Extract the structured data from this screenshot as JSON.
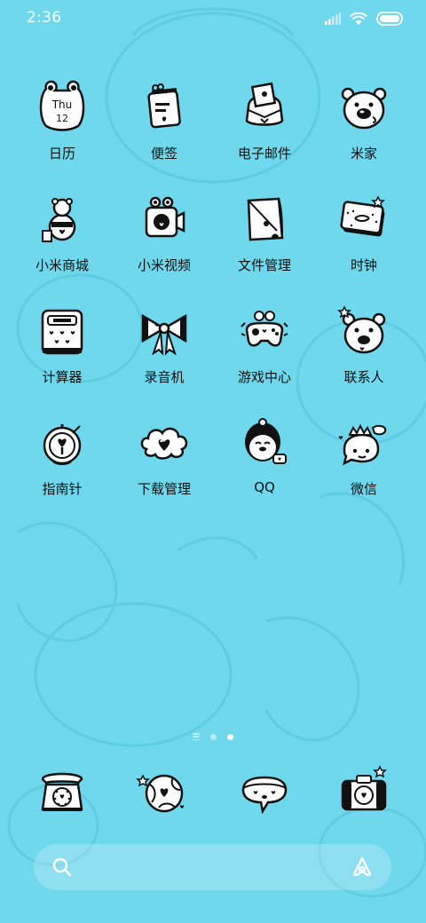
{
  "status_bar": {
    "time": "2:36"
  },
  "apps": [
    {
      "label": "日历",
      "icon": "calendar-icon",
      "date_weekday": "Thu",
      "date_day": "12"
    },
    {
      "label": "便签",
      "icon": "notes-icon"
    },
    {
      "label": "电子邮件",
      "icon": "email-icon"
    },
    {
      "label": "米家",
      "icon": "mijia-bear-icon"
    },
    {
      "label": "小米商城",
      "icon": "mi-store-icon"
    },
    {
      "label": "小米视频",
      "icon": "mi-video-icon"
    },
    {
      "label": "文件管理",
      "icon": "file-manager-icon"
    },
    {
      "label": "时钟",
      "icon": "clock-icon"
    },
    {
      "label": "计算器",
      "icon": "calculator-icon"
    },
    {
      "label": "录音机",
      "icon": "recorder-bow-icon"
    },
    {
      "label": "游戏中心",
      "icon": "game-center-icon"
    },
    {
      "label": "联系人",
      "icon": "contacts-bear-icon"
    },
    {
      "label": "指南针",
      "icon": "compass-icon"
    },
    {
      "label": "下载管理",
      "icon": "downloads-cloud-icon"
    },
    {
      "label": "QQ",
      "icon": "qq-penguin-icon"
    },
    {
      "label": "微信",
      "icon": "wechat-icon"
    }
  ],
  "page_indicator": {
    "pages": 2,
    "active_page": 2
  },
  "dock": [
    {
      "icon": "phone-icon"
    },
    {
      "icon": "browser-globe-icon"
    },
    {
      "icon": "messages-bubble-icon"
    },
    {
      "icon": "camera-icon"
    }
  ],
  "search_bar": {
    "icons": [
      "search-icon",
      "assistant-icon"
    ]
  },
  "colors": {
    "wallpaper": "#6fd8ec",
    "wallpaper_pattern": "#5fcde2",
    "icon_line": "#111111",
    "icon_fill": "#ffffff",
    "text": "#111111",
    "status_text": "#ffffff"
  }
}
